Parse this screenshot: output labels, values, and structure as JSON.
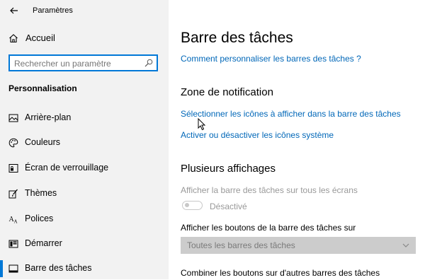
{
  "window": {
    "title": "Paramètres"
  },
  "sidebar": {
    "home_label": "Accueil",
    "search": {
      "placeholder": "Rechercher un paramètre",
      "value": ""
    },
    "section_heading": "Personnalisation",
    "items": [
      {
        "label": "Arrière-plan",
        "icon": "image-icon"
      },
      {
        "label": "Couleurs",
        "icon": "palette-icon"
      },
      {
        "label": "Écran de verrouillage",
        "icon": "lock-screen-icon"
      },
      {
        "label": "Thèmes",
        "icon": "brush-icon"
      },
      {
        "label": "Polices",
        "icon": "font-icon"
      },
      {
        "label": "Démarrer",
        "icon": "start-icon"
      },
      {
        "label": "Barre des tâches",
        "icon": "taskbar-icon",
        "active": true
      }
    ]
  },
  "main": {
    "title": "Barre des tâches",
    "help_link": "Comment personnaliser les barres des tâches ?",
    "notification": {
      "heading": "Zone de notification",
      "link1": "Sélectionner les icônes à afficher dans la barre des tâches",
      "link2": "Activer ou désactiver les icônes système"
    },
    "multi_display": {
      "heading": "Plusieurs affichages",
      "show_all_label": "Afficher la barre des tâches sur tous les écrans",
      "toggle_state": "Désactivé",
      "buttons_label": "Afficher les boutons de la barre des tâches sur",
      "dropdown_value": "Toutes les barres des tâches",
      "combine_label": "Combiner les boutons sur d'autres barres des tâches"
    }
  },
  "colors": {
    "accent": "#0078d7",
    "link": "#0067b8",
    "sidebar_bg": "#f2f2f2"
  }
}
